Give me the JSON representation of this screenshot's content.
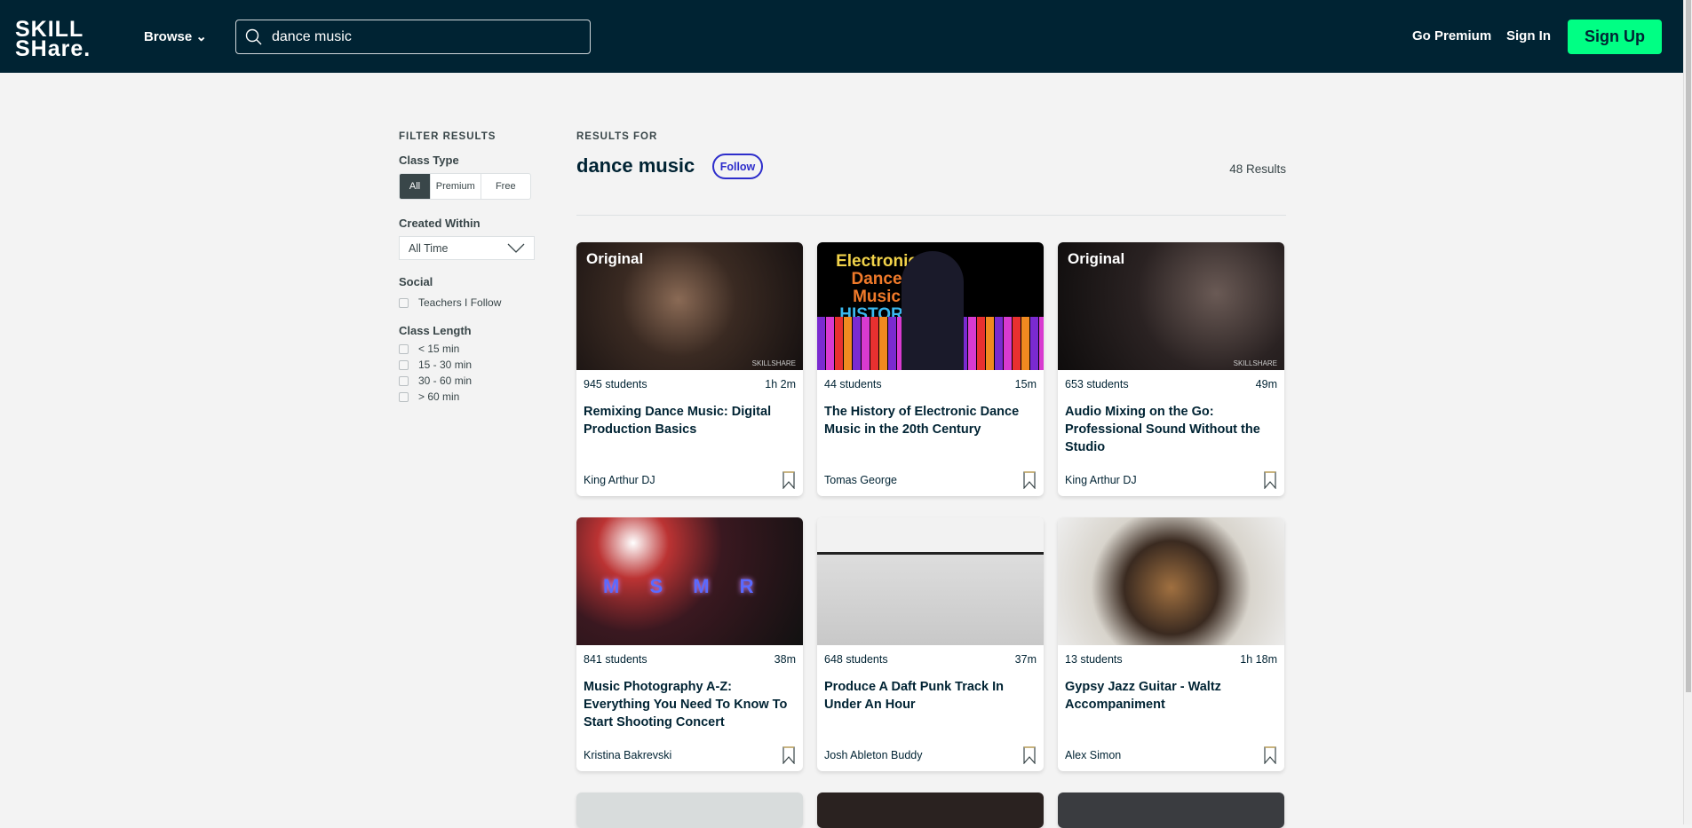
{
  "header": {
    "logo_line1": "SKILL",
    "logo_line2": "SHare.",
    "browse": "Browse",
    "search_value": "dance music",
    "go_premium": "Go Premium",
    "sign_in": "Sign In",
    "sign_up": "Sign Up"
  },
  "sidebar": {
    "heading": "FILTER RESULTS",
    "class_type": {
      "label": "Class Type",
      "options": [
        "All",
        "Premium",
        "Free"
      ],
      "selected": "All"
    },
    "created_within": {
      "label": "Created Within",
      "value": "All Time"
    },
    "social": {
      "label": "Social",
      "option": "Teachers I Follow"
    },
    "class_length": {
      "label": "Class Length",
      "options": [
        "< 15 min",
        "15 - 30 min",
        "30 - 60 min",
        "> 60 min"
      ]
    }
  },
  "results": {
    "label": "RESULTS FOR",
    "query": "dance music",
    "follow": "Follow",
    "count": "48 Results",
    "cards": [
      {
        "badge": "Original",
        "watermark": "SKILLSHARE",
        "students": "945 students",
        "duration": "1h 2m",
        "title": "Remixing Dance Music: Digital Production Basics",
        "author": "King Arthur DJ"
      },
      {
        "thumb_text": [
          "Electronic",
          "Dance Music",
          "HISTORY"
        ],
        "students": "44 students",
        "duration": "15m",
        "title": "The History of Electronic Dance Music in the 20th Century",
        "author": "Tomas George"
      },
      {
        "badge": "Original",
        "watermark": "SKILLSHARE",
        "students": "653 students",
        "duration": "49m",
        "title": "Audio Mixing on the Go: Professional Sound Without the Studio",
        "author": "King Arthur DJ"
      },
      {
        "thumb_text": [
          "M S  M R"
        ],
        "students": "841 students",
        "duration": "38m",
        "title": "Music Photography A-Z: Everything You Need To Know To Start Shooting Concert",
        "author": "Kristina Bakrevski"
      },
      {
        "students": "648 students",
        "duration": "37m",
        "title": "Produce A Daft Punk Track In Under An Hour",
        "author": "Josh Ableton Buddy"
      },
      {
        "students": "13 students",
        "duration": "1h 18m",
        "title": "Gypsy Jazz Guitar - Waltz Accompaniment",
        "author": "Alex Simon"
      }
    ]
  },
  "colors": {
    "header_bg": "#002333",
    "accent_green": "#00ff84",
    "follow_blue": "#2d2dcb"
  }
}
